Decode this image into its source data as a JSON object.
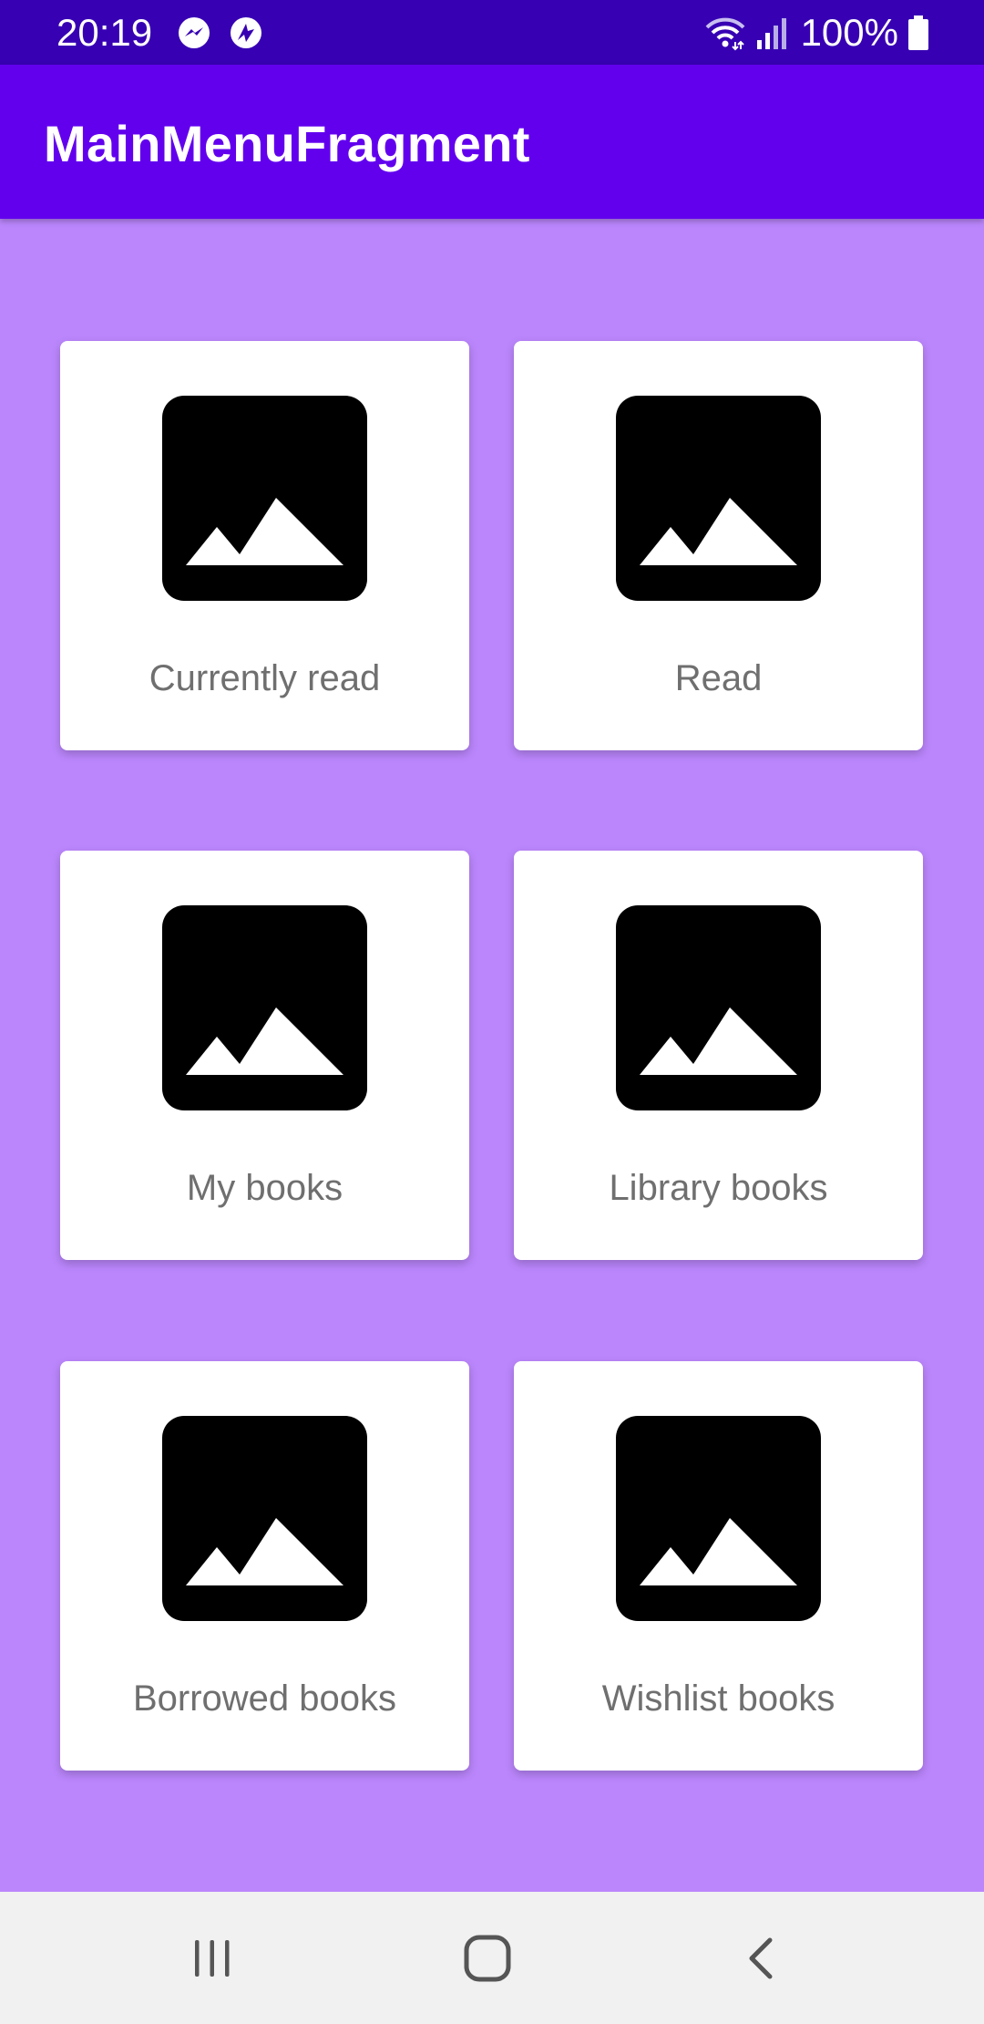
{
  "status_bar": {
    "time": "20:19",
    "battery": "100%",
    "icons": [
      "messenger-icon",
      "bolt-app-icon",
      "wifi-icon",
      "signal-icon",
      "battery-icon"
    ]
  },
  "app_bar": {
    "title": "MainMenuFragment"
  },
  "menu": {
    "items": [
      {
        "label": "Currently read",
        "icon": "image-placeholder-icon"
      },
      {
        "label": "Read",
        "icon": "image-placeholder-icon"
      },
      {
        "label": "My books",
        "icon": "image-placeholder-icon"
      },
      {
        "label": "Library books",
        "icon": "image-placeholder-icon"
      },
      {
        "label": "Borrowed books",
        "icon": "image-placeholder-icon"
      },
      {
        "label": "Wishlist books",
        "icon": "image-placeholder-icon"
      }
    ]
  },
  "nav_bar": {
    "buttons": [
      "recent-apps",
      "home",
      "back"
    ]
  },
  "colors": {
    "status_bar": "#3700b3",
    "app_bar": "#6200ee",
    "background": "#bb86fc",
    "card": "#ffffff",
    "label_text": "#6f6f6f",
    "nav_bar": "#f1f1f1"
  }
}
